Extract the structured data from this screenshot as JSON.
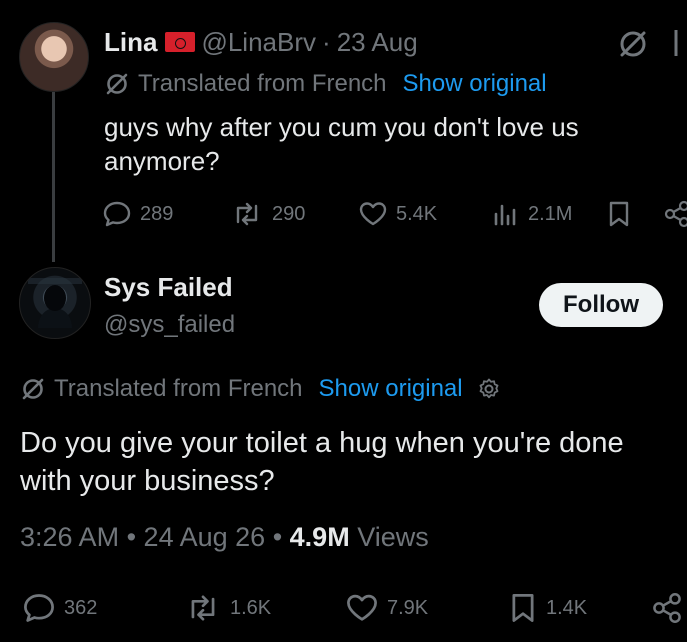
{
  "tweet1": {
    "name": "Lina",
    "handle": "@LinaBrv",
    "dot": "·",
    "date": "23 Aug",
    "translated_label": "Translated from French",
    "show_original": "Show original",
    "text": "guys why after you cum you don't love us anymore?",
    "replies": "289",
    "reposts": "290",
    "likes": "5.4K",
    "views": "2.1M"
  },
  "tweet2": {
    "name": "Sys Failed",
    "handle": "@sys_failed",
    "follow_label": "Follow",
    "translated_label": "Translated from French",
    "show_original": "Show original",
    "text": "Do you give your toilet a hug when you're done with your business?",
    "time": "3:26 AM",
    "date": "24 Aug 26",
    "views_count": "4.9M",
    "views_label": "Views",
    "replies": "362",
    "reposts": "1.6K",
    "likes": "7.9K",
    "bookmarks": "1.4K"
  },
  "colors": {
    "accent": "#1d9bf0",
    "muted": "#71767b",
    "text": "#e7e9ea",
    "background": "#000000"
  },
  "icons": [
    "grok-icon",
    "translate-icon",
    "reply-icon",
    "repost-icon",
    "like-icon",
    "views-icon",
    "bookmark-icon",
    "share-icon",
    "settings-icon"
  ]
}
